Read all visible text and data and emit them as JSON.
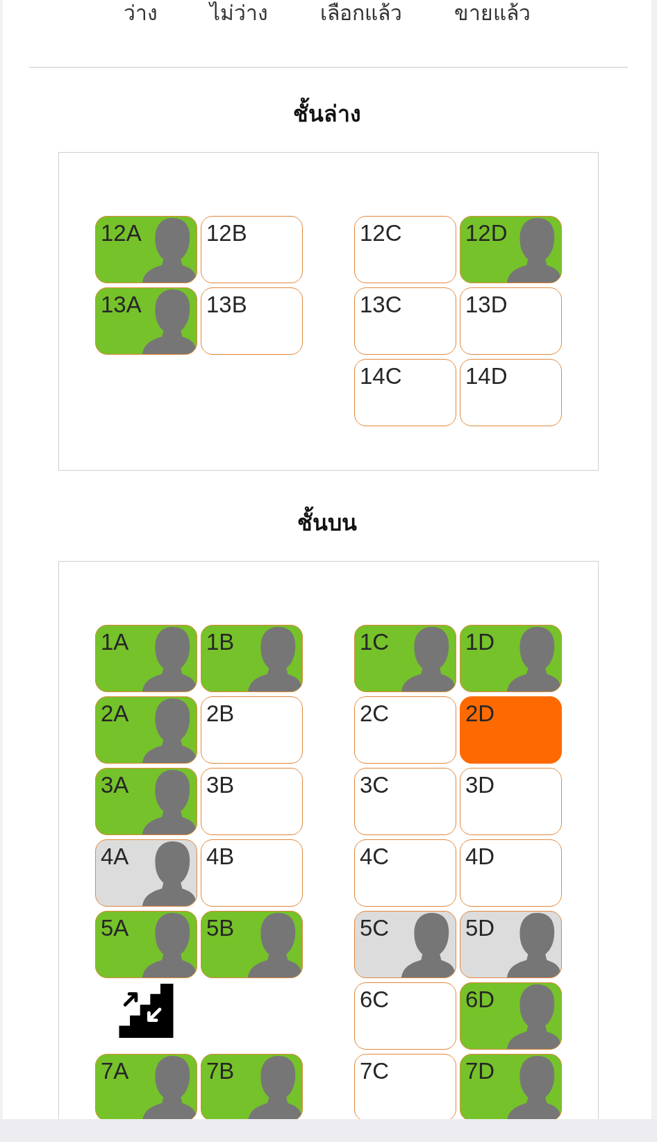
{
  "legend": [
    "ว่าง",
    "ไม่ว่าง",
    "เลือกแล้ว",
    "ขายแล้ว"
  ],
  "decks": [
    {
      "title": "ชั้นล่าง",
      "rows": [
        {
          "left": [
            {
              "kind": "seat",
              "label": "12A",
              "color": "#76c22a",
              "occupied": true,
              "selected": false
            },
            {
              "kind": "seat",
              "label": "12B",
              "color": "#ffffff",
              "occupied": false,
              "selected": false
            }
          ],
          "right": [
            {
              "kind": "seat",
              "label": "12C",
              "color": "#ffffff",
              "occupied": false,
              "selected": false
            },
            {
              "kind": "seat",
              "label": "12D",
              "color": "#76c22a",
              "occupied": true,
              "selected": false
            }
          ]
        },
        {
          "left": [
            {
              "kind": "seat",
              "label": "13A",
              "color": "#76c22a",
              "occupied": true,
              "selected": false
            },
            {
              "kind": "seat",
              "label": "13B",
              "color": "#ffffff",
              "occupied": false,
              "selected": false
            }
          ],
          "right": [
            {
              "kind": "seat",
              "label": "13C",
              "color": "#ffffff",
              "occupied": false,
              "selected": false
            },
            {
              "kind": "seat",
              "label": "13D",
              "color": "#ffffff",
              "occupied": false,
              "selected": false
            }
          ]
        },
        {
          "left": [],
          "right": [
            {
              "kind": "seat",
              "label": "14C",
              "color": "#ffffff",
              "occupied": false,
              "selected": false
            },
            {
              "kind": "seat",
              "label": "14D",
              "color": "#ffffff",
              "occupied": false,
              "selected": false
            }
          ]
        }
      ]
    },
    {
      "title": "ชั้นบน",
      "rows": [
        {
          "left": [
            {
              "kind": "seat",
              "label": "1A",
              "color": "#76c22a",
              "occupied": true,
              "selected": false
            },
            {
              "kind": "seat",
              "label": "1B",
              "color": "#76c22a",
              "occupied": true,
              "selected": false
            }
          ],
          "right": [
            {
              "kind": "seat",
              "label": "1C",
              "color": "#76c22a",
              "occupied": true,
              "selected": false
            },
            {
              "kind": "seat",
              "label": "1D",
              "color": "#76c22a",
              "occupied": true,
              "selected": false
            }
          ]
        },
        {
          "left": [
            {
              "kind": "seat",
              "label": "2A",
              "color": "#76c22a",
              "occupied": true,
              "selected": false
            },
            {
              "kind": "seat",
              "label": "2B",
              "color": "#ffffff",
              "occupied": false,
              "selected": false
            }
          ],
          "right": [
            {
              "kind": "seat",
              "label": "2C",
              "color": "#ffffff",
              "occupied": false,
              "selected": false
            },
            {
              "kind": "seat",
              "label": "2D",
              "occupied": false,
              "selected": true
            }
          ]
        },
        {
          "left": [
            {
              "kind": "seat",
              "label": "3A",
              "color": "#76c22a",
              "occupied": true,
              "selected": false
            },
            {
              "kind": "seat",
              "label": "3B",
              "color": "#ffffff",
              "occupied": false,
              "selected": false
            }
          ],
          "right": [
            {
              "kind": "seat",
              "label": "3C",
              "color": "#ffffff",
              "occupied": false,
              "selected": false
            },
            {
              "kind": "seat",
              "label": "3D",
              "color": "#ffffff",
              "occupied": false,
              "selected": false
            }
          ]
        },
        {
          "left": [
            {
              "kind": "seat",
              "label": "4A",
              "color": "#dcdcdc",
              "occupied": true,
              "selected": false
            },
            {
              "kind": "seat",
              "label": "4B",
              "color": "#ffffff",
              "occupied": false,
              "selected": false
            }
          ],
          "right": [
            {
              "kind": "seat",
              "label": "4C",
              "color": "#ffffff",
              "occupied": false,
              "selected": false
            },
            {
              "kind": "seat",
              "label": "4D",
              "color": "#ffffff",
              "occupied": false,
              "selected": false
            }
          ]
        },
        {
          "left": [
            {
              "kind": "seat",
              "label": "5A",
              "color": "#76c22a",
              "occupied": true,
              "selected": false
            },
            {
              "kind": "seat",
              "label": "5B",
              "color": "#76c22a",
              "occupied": true,
              "selected": false
            }
          ],
          "right": [
            {
              "kind": "seat",
              "label": "5C",
              "color": "#dcdcdc",
              "occupied": true,
              "selected": false
            },
            {
              "kind": "seat",
              "label": "5D",
              "color": "#dcdcdc",
              "occupied": true,
              "selected": false
            }
          ]
        },
        {
          "left": [
            {
              "kind": "stairs"
            }
          ],
          "right": [
            {
              "kind": "seat",
              "label": "6C",
              "color": "#ffffff",
              "occupied": false,
              "selected": false
            },
            {
              "kind": "seat",
              "label": "6D",
              "color": "#76c22a",
              "occupied": true,
              "selected": false
            }
          ]
        },
        {
          "left": [
            {
              "kind": "seat",
              "label": "7A",
              "color": "#76c22a",
              "occupied": true,
              "selected": false
            },
            {
              "kind": "seat",
              "label": "7B",
              "color": "#76c22a",
              "occupied": true,
              "selected": false
            }
          ],
          "right": [
            {
              "kind": "seat",
              "label": "7C",
              "color": "#ffffff",
              "occupied": false,
              "selected": false
            },
            {
              "kind": "seat",
              "label": "7D",
              "color": "#76c22a",
              "occupied": true,
              "selected": false
            }
          ]
        }
      ]
    }
  ]
}
